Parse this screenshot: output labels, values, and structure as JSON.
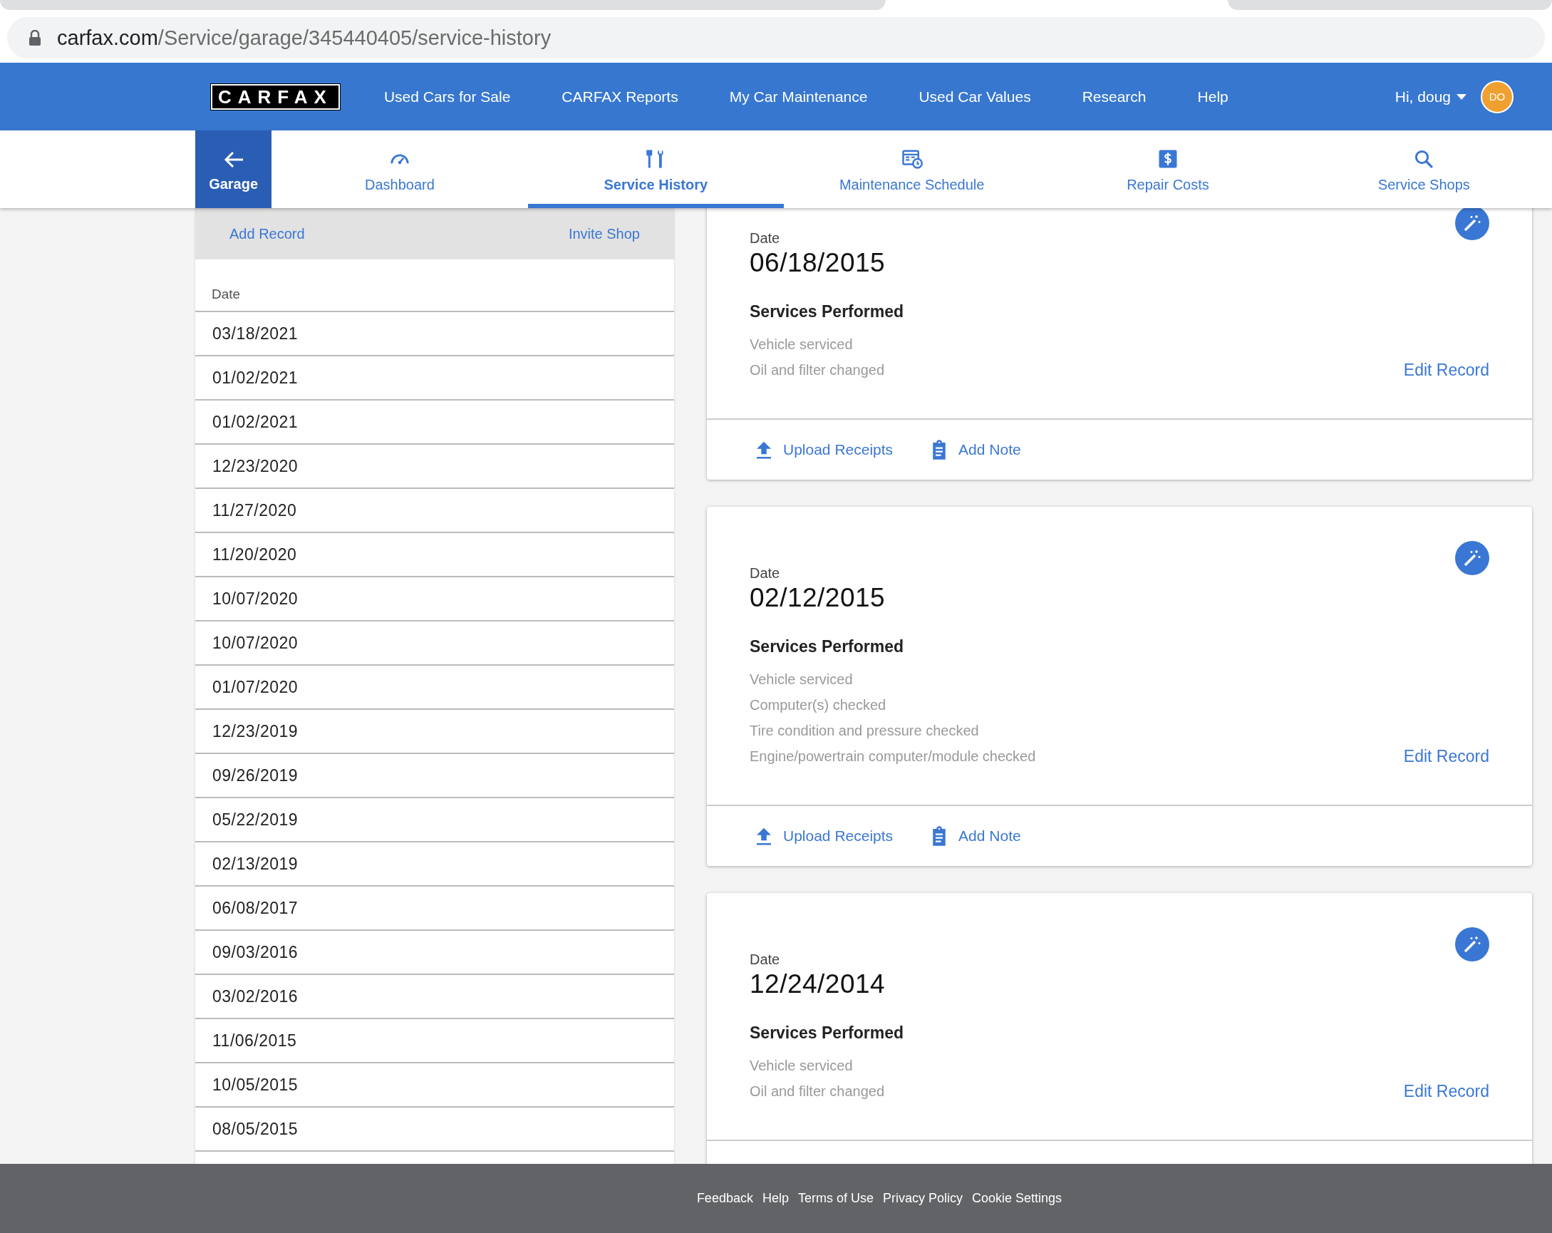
{
  "browser": {
    "url_host": "carfax.com",
    "url_path": "/Service/garage/345440405/service-history"
  },
  "nav": {
    "logo": "CARFAX",
    "links": [
      "Used Cars for Sale",
      "CARFAX Reports",
      "My Car Maintenance",
      "Used Car Values",
      "Research",
      "Help"
    ],
    "greeting": "Hi, doug",
    "avatar": "DO"
  },
  "subnav": {
    "back": "Garage",
    "tabs": [
      {
        "label": "Dashboard",
        "kind": "gauge",
        "selected": false
      },
      {
        "label": "Service History",
        "kind": "tools",
        "selected": true
      },
      {
        "label": "Maintenance Schedule",
        "kind": "schedule",
        "selected": false
      },
      {
        "label": "Repair Costs",
        "kind": "dollar",
        "selected": false
      },
      {
        "label": "Service Shops",
        "kind": "search",
        "selected": false
      }
    ]
  },
  "sidebar": {
    "actions": [
      "Add Record",
      "Invite Shop"
    ],
    "column": "Date",
    "dates": [
      "03/18/2021",
      "01/02/2021",
      "01/02/2021",
      "12/23/2020",
      "11/27/2020",
      "11/20/2020",
      "10/07/2020",
      "10/07/2020",
      "01/07/2020",
      "12/23/2019",
      "09/26/2019",
      "05/22/2019",
      "02/13/2019",
      "06/08/2017",
      "09/03/2016",
      "03/02/2016",
      "11/06/2015",
      "10/05/2015",
      "08/05/2015"
    ]
  },
  "records": [
    {
      "date_label": "Date",
      "date": "06/18/2015",
      "heading": "Services Performed",
      "services": [
        "Vehicle serviced",
        "Oil and filter changed"
      ],
      "edit": "Edit Record",
      "actions": [
        {
          "label": "Upload Receipts",
          "kind": "upload"
        },
        {
          "label": "Add Note",
          "kind": "note"
        }
      ]
    },
    {
      "date_label": "Date",
      "date": "02/12/2015",
      "heading": "Services Performed",
      "services": [
        "Vehicle serviced",
        "Computer(s) checked",
        "Tire condition and pressure checked",
        "Engine/powertrain computer/module checked"
      ],
      "edit": "Edit Record",
      "actions": [
        {
          "label": "Upload Receipts",
          "kind": "upload"
        },
        {
          "label": "Add Note",
          "kind": "note"
        }
      ]
    },
    {
      "date_label": "Date",
      "date": "12/24/2014",
      "heading": "Services Performed",
      "services": [
        "Vehicle serviced",
        "Oil and filter changed"
      ],
      "edit": "Edit Record"
    }
  ],
  "footer": {
    "links": [
      "Feedback",
      "Help",
      "Terms of Use",
      "Privacy Policy",
      "Cookie Settings"
    ]
  }
}
